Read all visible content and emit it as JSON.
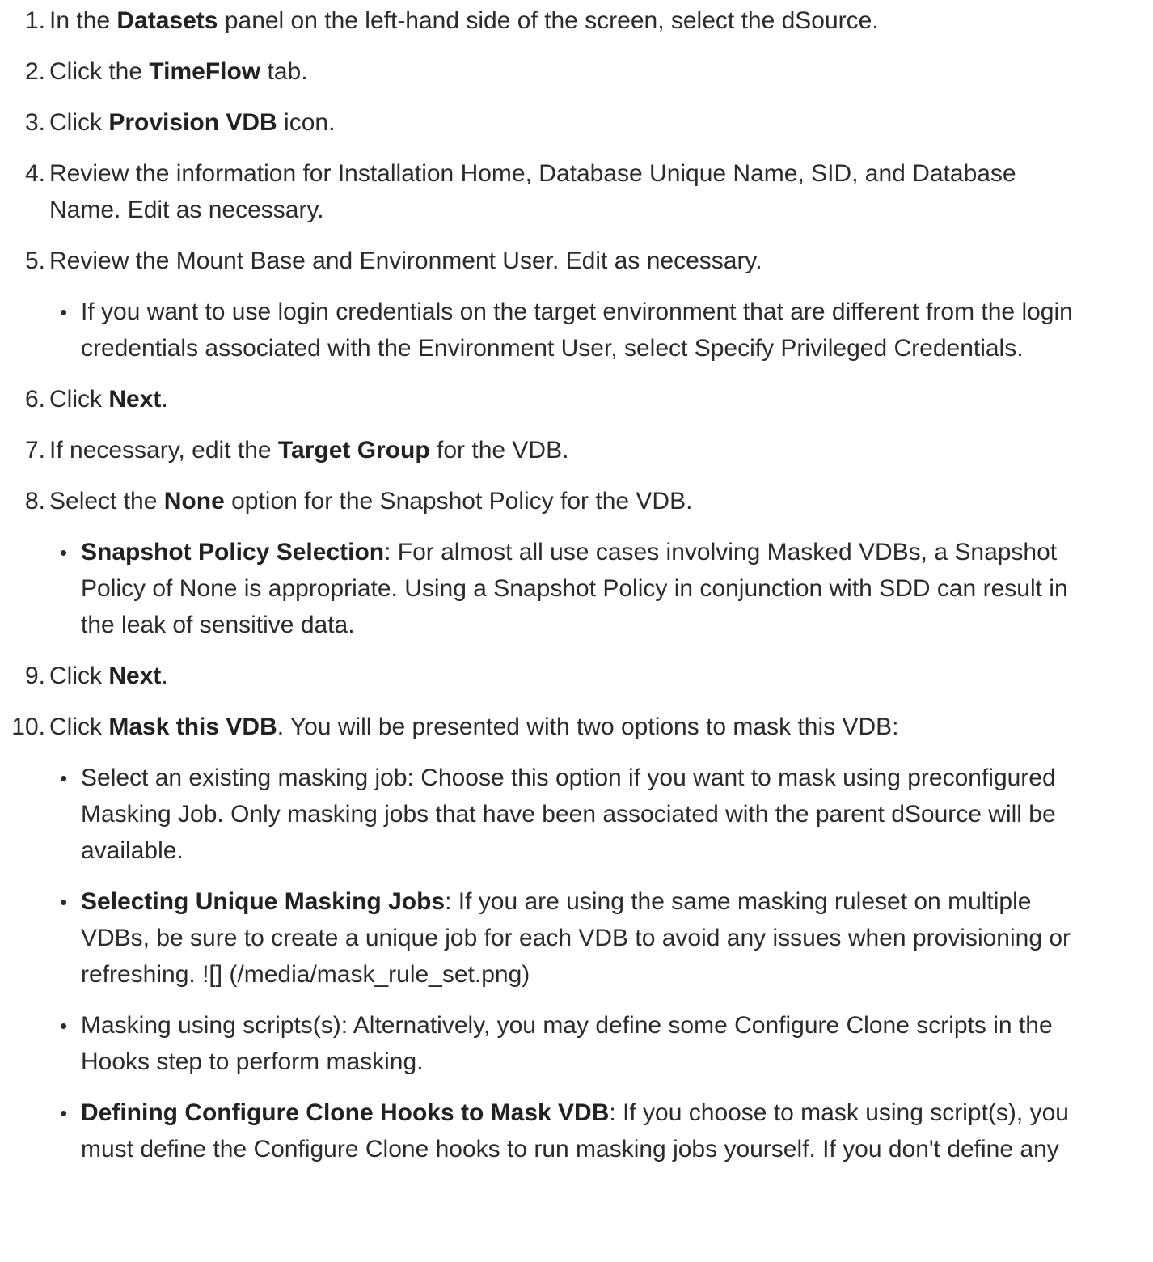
{
  "steps": [
    {
      "num": "1.",
      "lines": [
        {
          "parts": [
            {
              "t": "In the "
            },
            {
              "t": "Datasets",
              "b": true
            },
            {
              "t": " panel on the left-hand side of the screen, select the dSource."
            }
          ]
        }
      ]
    },
    {
      "num": "2.",
      "lines": [
        {
          "parts": [
            {
              "t": "Click the "
            },
            {
              "t": "TimeFlow",
              "b": true
            },
            {
              "t": " tab."
            }
          ]
        }
      ]
    },
    {
      "num": "3.",
      "lines": [
        {
          "parts": [
            {
              "t": "Click "
            },
            {
              "t": "Provision VDB",
              "b": true
            },
            {
              "t": " icon."
            }
          ]
        }
      ]
    },
    {
      "num": "4.",
      "lines": [
        {
          "parts": [
            {
              "t": "Review the information for Installation Home, Database Unique Name, SID, and Database"
            }
          ]
        },
        {
          "parts": [
            {
              "t": "Name. Edit as necessary."
            }
          ]
        }
      ]
    },
    {
      "num": "5.",
      "lines": [
        {
          "parts": [
            {
              "t": "Review the Mount Base and Environment User. Edit as necessary."
            }
          ]
        }
      ]
    },
    {
      "bullet": true,
      "lines": [
        {
          "parts": [
            {
              "t": "If you want to use login credentials on the target environment that are different from the login"
            }
          ]
        },
        {
          "parts": [
            {
              "t": "credentials associated with the Environment User, select Specify Privileged Credentials."
            }
          ]
        }
      ]
    },
    {
      "num": "6.",
      "lines": [
        {
          "parts": [
            {
              "t": "Click "
            },
            {
              "t": "Next",
              "b": true
            },
            {
              "t": "."
            }
          ]
        }
      ]
    },
    {
      "num": "7.",
      "lines": [
        {
          "parts": [
            {
              "t": "If necessary, edit the "
            },
            {
              "t": "Target Group",
              "b": true
            },
            {
              "t": " for the VDB."
            }
          ]
        }
      ]
    },
    {
      "num": "8.",
      "lines": [
        {
          "parts": [
            {
              "t": "Select the "
            },
            {
              "t": "None",
              "b": true
            },
            {
              "t": " option for the Snapshot Policy for the VDB."
            }
          ]
        }
      ]
    },
    {
      "bullet": true,
      "lines": [
        {
          "parts": [
            {
              "t": "Snapshot Policy Selection",
              "b": true
            },
            {
              "t": ": For almost all use cases involving Masked VDBs, a Snapshot"
            }
          ]
        },
        {
          "parts": [
            {
              "t": "Policy of None is appropriate. Using a Snapshot Policy in conjunction with SDD can result in"
            }
          ]
        },
        {
          "parts": [
            {
              "t": "the leak of sensitive data."
            }
          ]
        }
      ]
    },
    {
      "num": "9.",
      "lines": [
        {
          "parts": [
            {
              "t": "Click "
            },
            {
              "t": "Next",
              "b": true
            },
            {
              "t": "."
            }
          ]
        }
      ]
    },
    {
      "num": "10.",
      "lines": [
        {
          "parts": [
            {
              "t": "Click "
            },
            {
              "t": "Mask this VDB",
              "b": true
            },
            {
              "t": ". You will be presented with two options to mask this VDB:"
            }
          ]
        }
      ]
    },
    {
      "bullet": true,
      "lines": [
        {
          "parts": [
            {
              "t": "Select an existing masking job: Choose this option if you want to mask using preconfigured"
            }
          ]
        },
        {
          "parts": [
            {
              "t": "Masking Job. Only masking jobs that have been associated with the parent dSource will be"
            }
          ]
        },
        {
          "parts": [
            {
              "t": "available."
            }
          ]
        }
      ]
    },
    {
      "bullet": true,
      "lines": [
        {
          "parts": [
            {
              "t": "Selecting Unique Masking Jobs",
              "b": true
            },
            {
              "t": ": If you are using the same masking ruleset on multiple"
            }
          ]
        },
        {
          "parts": [
            {
              "t": "VDBs, be sure to create a unique job for each VDB to avoid any issues when provisioning or"
            }
          ]
        },
        {
          "parts": [
            {
              "t": "refreshing. ![] (/media/mask_rule_set.png)"
            }
          ]
        }
      ]
    },
    {
      "bullet": true,
      "lines": [
        {
          "parts": [
            {
              "t": "Masking using scripts(s): Alternatively, you may define some Configure Clone scripts in the"
            }
          ]
        },
        {
          "parts": [
            {
              "t": "Hooks step to perform masking."
            }
          ]
        }
      ]
    },
    {
      "bullet": true,
      "lines": [
        {
          "parts": [
            {
              "t": "Defining Configure Clone Hooks to Mask VDB",
              "b": true
            },
            {
              "t": ": If you choose to mask using script(s), you"
            }
          ]
        },
        {
          "parts": [
            {
              "t": "must define the Configure Clone hooks to run masking jobs yourself. If you don't define any"
            }
          ]
        }
      ]
    }
  ]
}
